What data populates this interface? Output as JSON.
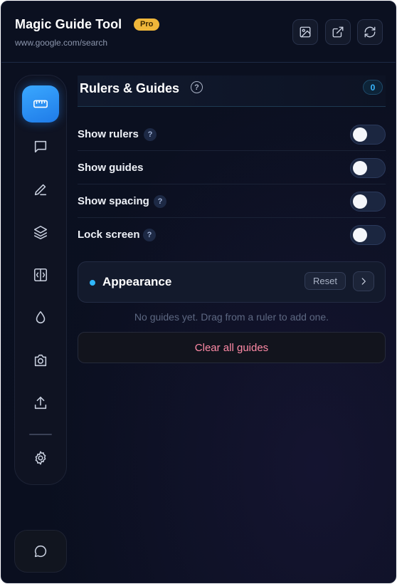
{
  "header": {
    "app_title": "Magic Guide Tool",
    "badge": "Pro",
    "url": "www.google.com/search",
    "buttons": [
      {
        "icon": "image-icon"
      },
      {
        "icon": "external-link-icon"
      },
      {
        "icon": "refresh-icon"
      }
    ]
  },
  "sidebar": {
    "items": [
      {
        "icon": "ruler-icon",
        "active": true
      },
      {
        "icon": "comment-icon"
      },
      {
        "icon": "pen-icon"
      },
      {
        "icon": "layers-icon"
      },
      {
        "icon": "code-compare-icon"
      },
      {
        "icon": "droplet-icon"
      },
      {
        "icon": "camera-icon"
      },
      {
        "icon": "upload-icon"
      },
      {
        "icon": "gear-icon"
      }
    ],
    "chat_icon": "chat-bubble-icon"
  },
  "section": {
    "title": "Rulers & Guides",
    "help": "?",
    "count": "0"
  },
  "settings": [
    {
      "label": "Show rulers",
      "help": "?",
      "on": false
    },
    {
      "label": "Show guides",
      "on": false
    },
    {
      "label": "Show spacing",
      "help": "?",
      "on": false
    },
    {
      "label": "Lock screen",
      "help": "?",
      "on": false
    }
  ],
  "appearance": {
    "label": "Appearance",
    "reset_label": "Reset"
  },
  "empty_hint": "No guides yet. Drag from a ruler to add one.",
  "clear_label": "Clear all guides",
  "colors": {
    "accent": "#2fb8ff",
    "badge": "#f0b73a",
    "danger_text": "#ff8aa6"
  }
}
